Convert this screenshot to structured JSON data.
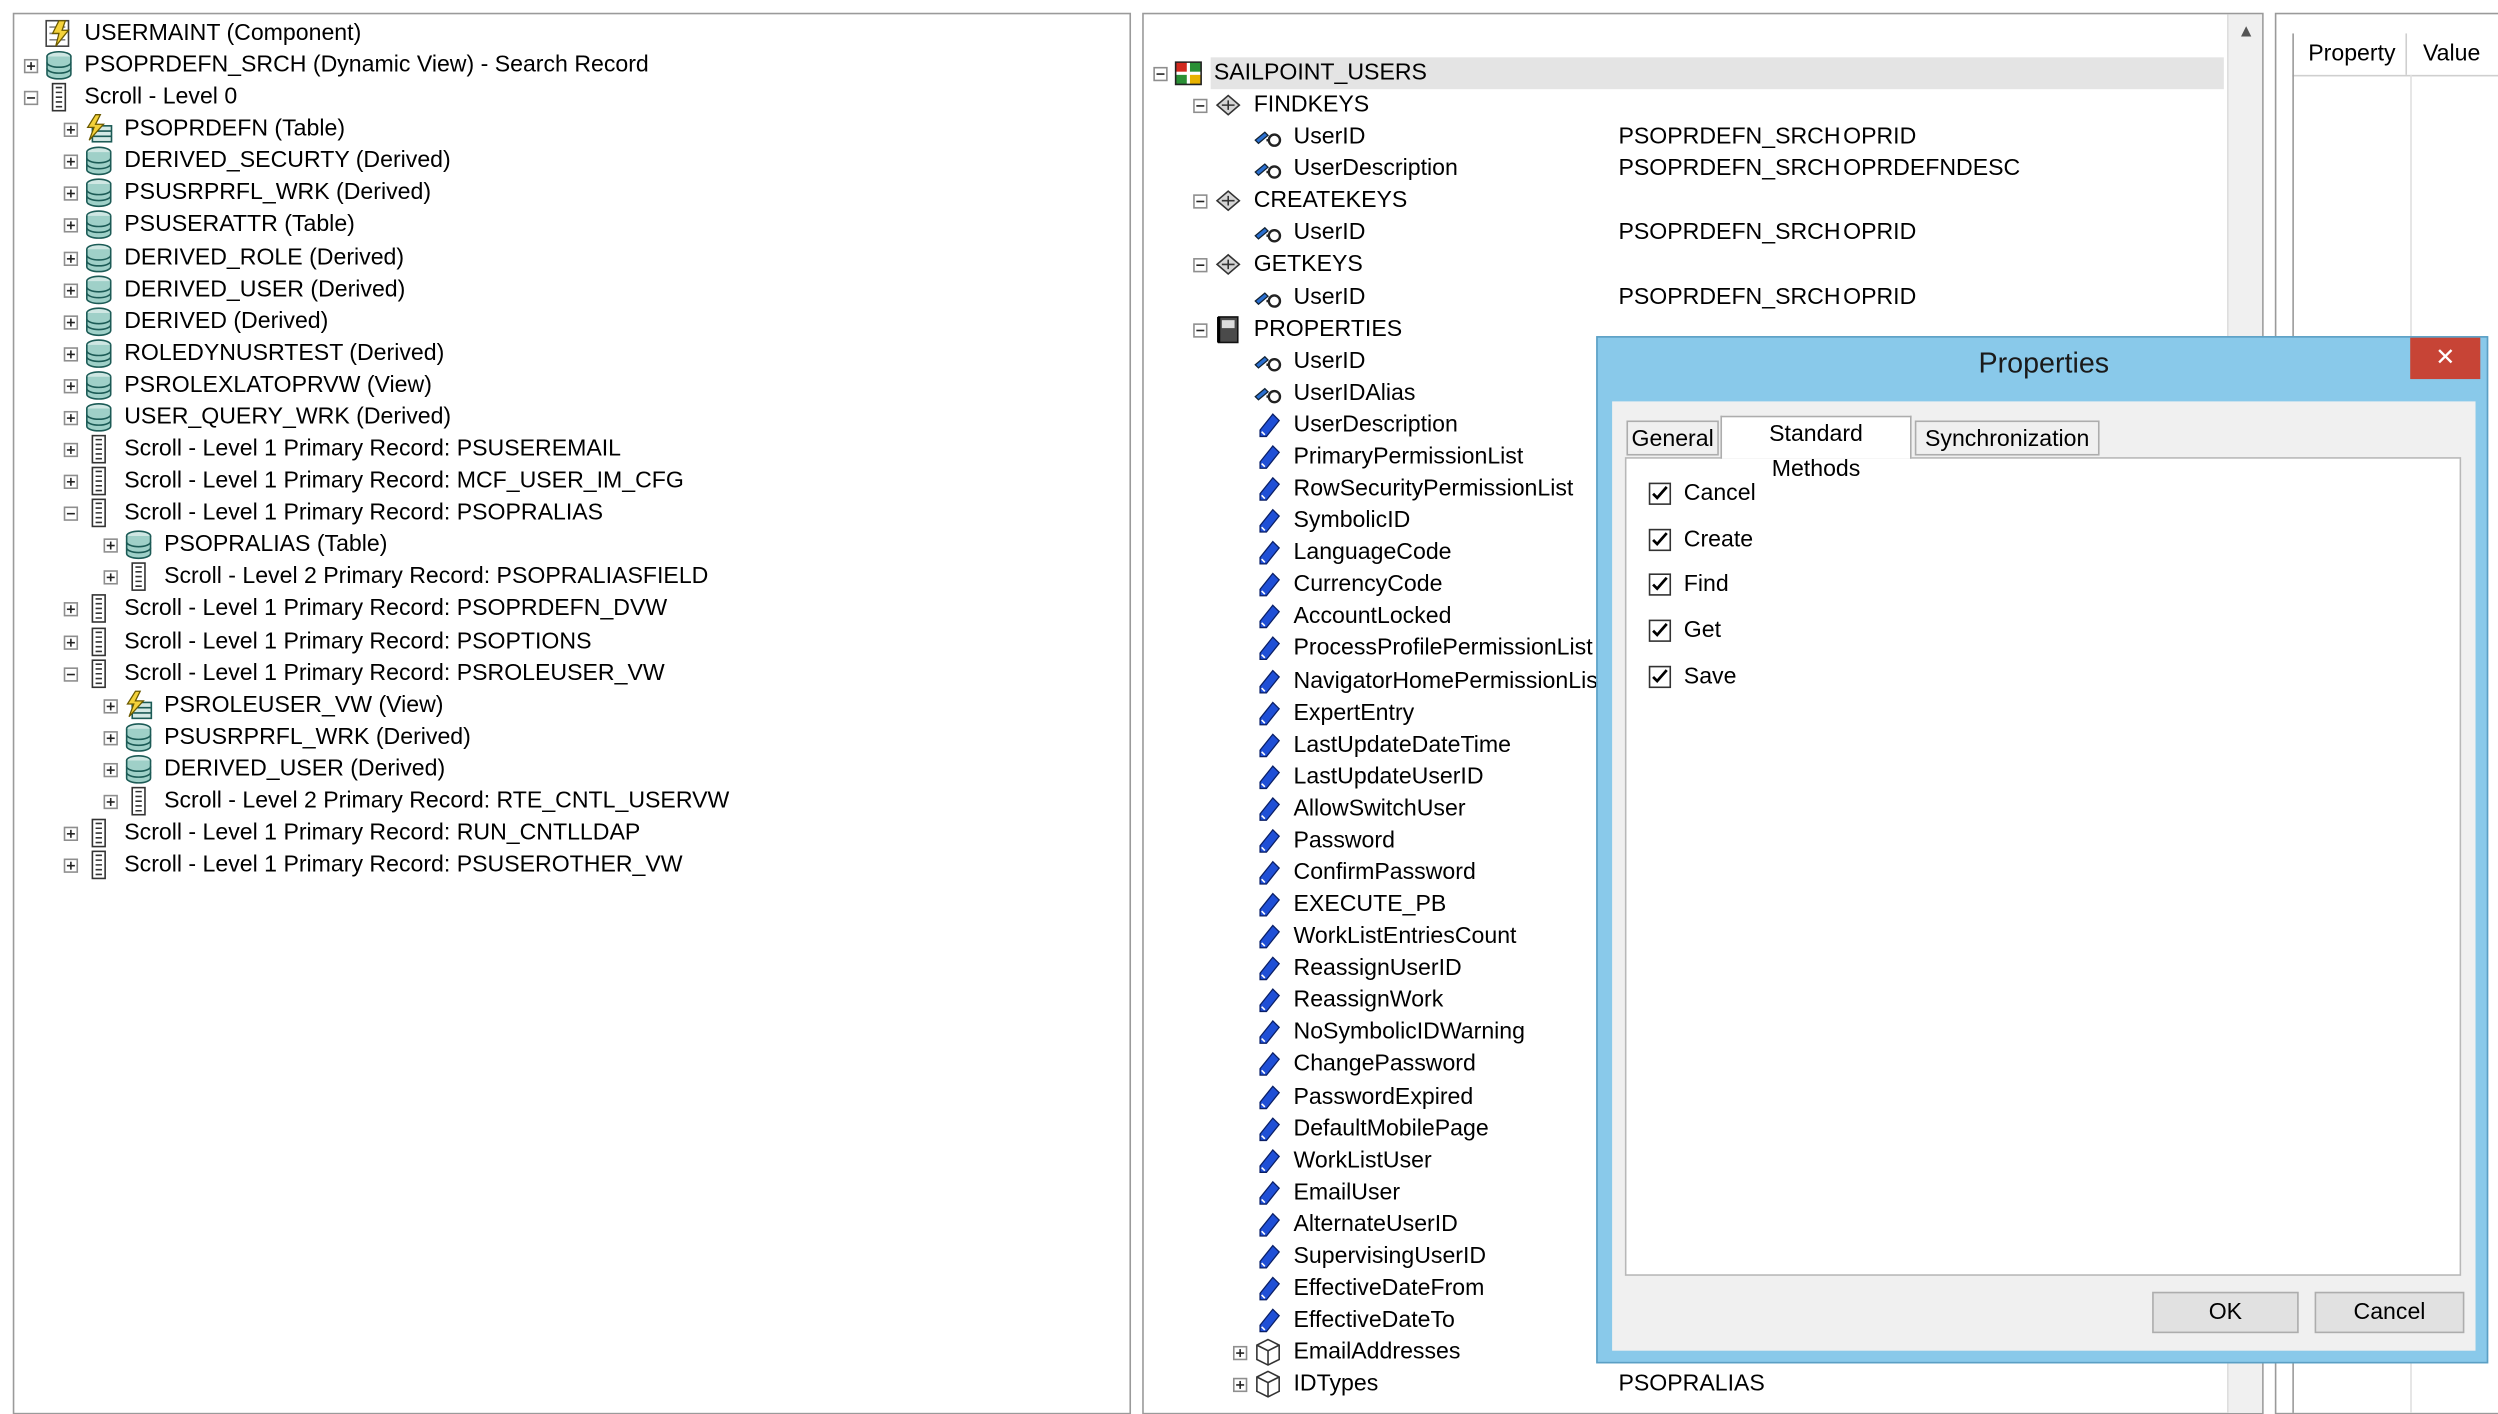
{
  "left_tree": [
    {
      "depth": 0,
      "tog": "none",
      "icon": "component",
      "label": "USERMAINT (Component)"
    },
    {
      "depth": 0,
      "tog": "plus",
      "icon": "db",
      "label": "PSOPRDEFN_SRCH (Dynamic View) - Search Record"
    },
    {
      "depth": 0,
      "tog": "minus",
      "icon": "scroll",
      "label": "Scroll - Level 0"
    },
    {
      "depth": 1,
      "tog": "plus",
      "icon": "table",
      "label": "PSOPRDEFN (Table)"
    },
    {
      "depth": 1,
      "tog": "plus",
      "icon": "db",
      "label": "DERIVED_SECURTY (Derived)"
    },
    {
      "depth": 1,
      "tog": "plus",
      "icon": "db",
      "label": "PSUSRPRFL_WRK (Derived)"
    },
    {
      "depth": 1,
      "tog": "plus",
      "icon": "db",
      "label": "PSUSERATTR (Table)"
    },
    {
      "depth": 1,
      "tog": "plus",
      "icon": "db",
      "label": "DERIVED_ROLE (Derived)"
    },
    {
      "depth": 1,
      "tog": "plus",
      "icon": "db",
      "label": "DERIVED_USER (Derived)"
    },
    {
      "depth": 1,
      "tog": "plus",
      "icon": "db",
      "label": "DERIVED (Derived)"
    },
    {
      "depth": 1,
      "tog": "plus",
      "icon": "db",
      "label": "ROLEDYNUSRTEST (Derived)"
    },
    {
      "depth": 1,
      "tog": "plus",
      "icon": "db",
      "label": "PSROLEXLATOPRVW (View)"
    },
    {
      "depth": 1,
      "tog": "plus",
      "icon": "db",
      "label": "USER_QUERY_WRK (Derived)"
    },
    {
      "depth": 1,
      "tog": "plus",
      "icon": "scroll",
      "label": "Scroll - Level 1  Primary Record: PSUSEREMAIL"
    },
    {
      "depth": 1,
      "tog": "plus",
      "icon": "scroll",
      "label": "Scroll - Level 1  Primary Record: MCF_USER_IM_CFG"
    },
    {
      "depth": 1,
      "tog": "minus",
      "icon": "scroll",
      "label": "Scroll - Level 1  Primary Record: PSOPRALIAS"
    },
    {
      "depth": 2,
      "tog": "plus",
      "icon": "db",
      "label": "PSOPRALIAS (Table)"
    },
    {
      "depth": 2,
      "tog": "plus",
      "icon": "scroll",
      "label": "Scroll - Level 2  Primary Record: PSOPRALIASFIELD"
    },
    {
      "depth": 1,
      "tog": "plus",
      "icon": "scroll",
      "label": "Scroll - Level 1  Primary Record: PSOPRDEFN_DVW"
    },
    {
      "depth": 1,
      "tog": "plus",
      "icon": "scroll",
      "label": "Scroll - Level 1  Primary Record: PSOPTIONS"
    },
    {
      "depth": 1,
      "tog": "minus",
      "icon": "scroll",
      "label": "Scroll - Level 1  Primary Record: PSROLEUSER_VW"
    },
    {
      "depth": 2,
      "tog": "plus",
      "icon": "table",
      "label": "PSROLEUSER_VW (View)"
    },
    {
      "depth": 2,
      "tog": "plus",
      "icon": "db",
      "label": "PSUSRPRFL_WRK (Derived)"
    },
    {
      "depth": 2,
      "tog": "plus",
      "icon": "db",
      "label": "DERIVED_USER (Derived)"
    },
    {
      "depth": 2,
      "tog": "plus",
      "icon": "scroll",
      "label": "Scroll - Level 2  Primary Record: RTE_CNTL_USERVW"
    },
    {
      "depth": 1,
      "tog": "plus",
      "icon": "scroll",
      "label": "Scroll - Level 1  Primary Record: RUN_CNTLLDAP"
    },
    {
      "depth": 1,
      "tog": "plus",
      "icon": "scroll",
      "label": "Scroll - Level 1  Primary Record: PSUSEROTHER_VW"
    }
  ],
  "mid_tree": [
    {
      "depth": 0,
      "tog": "minus",
      "icon": "ci",
      "label": "SAILPOINT_USERS",
      "col3": "",
      "col4": "",
      "sel": true
    },
    {
      "depth": 1,
      "tog": "minus",
      "icon": "keys",
      "label": "FINDKEYS",
      "col3": "",
      "col4": ""
    },
    {
      "depth": 2,
      "tog": "none",
      "icon": "key",
      "label": "UserID",
      "col3": "PSOPRDEFN_SRCH",
      "col4": "OPRID"
    },
    {
      "depth": 2,
      "tog": "none",
      "icon": "key",
      "label": "UserDescription",
      "col3": "PSOPRDEFN_SRCH",
      "col4": "OPRDEFNDESC"
    },
    {
      "depth": 1,
      "tog": "minus",
      "icon": "keys",
      "label": "CREATEKEYS",
      "col3": "",
      "col4": ""
    },
    {
      "depth": 2,
      "tog": "none",
      "icon": "key",
      "label": "UserID",
      "col3": "PSOPRDEFN_SRCH",
      "col4": "OPRID"
    },
    {
      "depth": 1,
      "tog": "minus",
      "icon": "keys",
      "label": "GETKEYS",
      "col3": "",
      "col4": ""
    },
    {
      "depth": 2,
      "tog": "none",
      "icon": "key",
      "label": "UserID",
      "col3": "PSOPRDEFN_SRCH",
      "col4": "OPRID"
    },
    {
      "depth": 1,
      "tog": "minus",
      "icon": "book",
      "label": "PROPERTIES",
      "col3": "",
      "col4": ""
    },
    {
      "depth": 2,
      "tog": "none",
      "icon": "key",
      "label": "UserID",
      "col3": "",
      "col4": ""
    },
    {
      "depth": 2,
      "tog": "none",
      "icon": "key",
      "label": "UserIDAlias",
      "col3": "",
      "col4": ""
    },
    {
      "depth": 2,
      "tog": "none",
      "icon": "prop",
      "label": "UserDescription",
      "col3": "",
      "col4": ""
    },
    {
      "depth": 2,
      "tog": "none",
      "icon": "prop",
      "label": "PrimaryPermissionList",
      "col3": "",
      "col4": ""
    },
    {
      "depth": 2,
      "tog": "none",
      "icon": "prop",
      "label": "RowSecurityPermissionList",
      "col3": "",
      "col4": ""
    },
    {
      "depth": 2,
      "tog": "none",
      "icon": "prop",
      "label": "SymbolicID",
      "col3": "",
      "col4": ""
    },
    {
      "depth": 2,
      "tog": "none",
      "icon": "prop",
      "label": "LanguageCode",
      "col3": "",
      "col4": ""
    },
    {
      "depth": 2,
      "tog": "none",
      "icon": "prop",
      "label": "CurrencyCode",
      "col3": "",
      "col4": ""
    },
    {
      "depth": 2,
      "tog": "none",
      "icon": "prop",
      "label": "AccountLocked",
      "col3": "",
      "col4": ""
    },
    {
      "depth": 2,
      "tog": "none",
      "icon": "prop",
      "label": "ProcessProfilePermissionList",
      "col3": "",
      "col4": ""
    },
    {
      "depth": 2,
      "tog": "none",
      "icon": "prop",
      "label": "NavigatorHomePermissionList",
      "col3": "",
      "col4": ""
    },
    {
      "depth": 2,
      "tog": "none",
      "icon": "prop",
      "label": "ExpertEntry",
      "col3": "",
      "col4": ""
    },
    {
      "depth": 2,
      "tog": "none",
      "icon": "prop",
      "label": "LastUpdateDateTime",
      "col3": "",
      "col4": ""
    },
    {
      "depth": 2,
      "tog": "none",
      "icon": "prop",
      "label": "LastUpdateUserID",
      "col3": "",
      "col4": ""
    },
    {
      "depth": 2,
      "tog": "none",
      "icon": "prop",
      "label": "AllowSwitchUser",
      "col3": "",
      "col4": ""
    },
    {
      "depth": 2,
      "tog": "none",
      "icon": "prop",
      "label": "Password",
      "col3": "",
      "col4": ""
    },
    {
      "depth": 2,
      "tog": "none",
      "icon": "prop",
      "label": "ConfirmPassword",
      "col3": "",
      "col4": ""
    },
    {
      "depth": 2,
      "tog": "none",
      "icon": "prop",
      "label": "EXECUTE_PB",
      "col3": "",
      "col4": ""
    },
    {
      "depth": 2,
      "tog": "none",
      "icon": "prop",
      "label": "WorkListEntriesCount",
      "col3": "",
      "col4": ""
    },
    {
      "depth": 2,
      "tog": "none",
      "icon": "prop",
      "label": "ReassignUserID",
      "col3": "",
      "col4": ""
    },
    {
      "depth": 2,
      "tog": "none",
      "icon": "prop",
      "label": "ReassignWork",
      "col3": "",
      "col4": ""
    },
    {
      "depth": 2,
      "tog": "none",
      "icon": "prop",
      "label": "NoSymbolicIDWarning",
      "col3": "",
      "col4": ""
    },
    {
      "depth": 2,
      "tog": "none",
      "icon": "prop",
      "label": "ChangePassword",
      "col3": "",
      "col4": ""
    },
    {
      "depth": 2,
      "tog": "none",
      "icon": "prop",
      "label": "PasswordExpired",
      "col3": "",
      "col4": ""
    },
    {
      "depth": 2,
      "tog": "none",
      "icon": "prop",
      "label": "DefaultMobilePage",
      "col3": "",
      "col4": ""
    },
    {
      "depth": 2,
      "tog": "none",
      "icon": "prop",
      "label": "WorkListUser",
      "col3": "",
      "col4": ""
    },
    {
      "depth": 2,
      "tog": "none",
      "icon": "prop",
      "label": "EmailUser",
      "col3": "",
      "col4": ""
    },
    {
      "depth": 2,
      "tog": "none",
      "icon": "prop",
      "label": "AlternateUserID",
      "col3": "",
      "col4": ""
    },
    {
      "depth": 2,
      "tog": "none",
      "icon": "prop",
      "label": "SupervisingUserID",
      "col3": "",
      "col4": ""
    },
    {
      "depth": 2,
      "tog": "none",
      "icon": "prop",
      "label": "EffectiveDateFrom",
      "col3": "",
      "col4": ""
    },
    {
      "depth": 2,
      "tog": "none",
      "icon": "prop",
      "label": "EffectiveDateTo",
      "col3": "",
      "col4": ""
    },
    {
      "depth": 2,
      "tog": "plus",
      "icon": "coll",
      "label": "EmailAddresses",
      "col3": "",
      "col4": ""
    },
    {
      "depth": 2,
      "tog": "plus",
      "icon": "coll",
      "label": "IDTypes",
      "col3": "PSOPRALIAS",
      "col4": ""
    }
  ],
  "right_panel": {
    "col_property": "Property",
    "col_value": "Value"
  },
  "dialog": {
    "title": "Properties",
    "close_glyph": "✕",
    "tabs": [
      "General",
      "Standard Methods",
      "Synchronization"
    ],
    "active_tab": 1,
    "methods": [
      {
        "label": "Cancel",
        "checked": true
      },
      {
        "label": "Create",
        "checked": true
      },
      {
        "label": "Find",
        "checked": true
      },
      {
        "label": "Get",
        "checked": true
      },
      {
        "label": "Save",
        "checked": true
      }
    ],
    "ok_label": "OK",
    "cancel_label": "Cancel"
  },
  "colors": {
    "selection": "#e4e4e4",
    "dialog_frame": "#89c9ea",
    "close_red": "#c74436",
    "prop_blue": "#1f4fd6"
  }
}
